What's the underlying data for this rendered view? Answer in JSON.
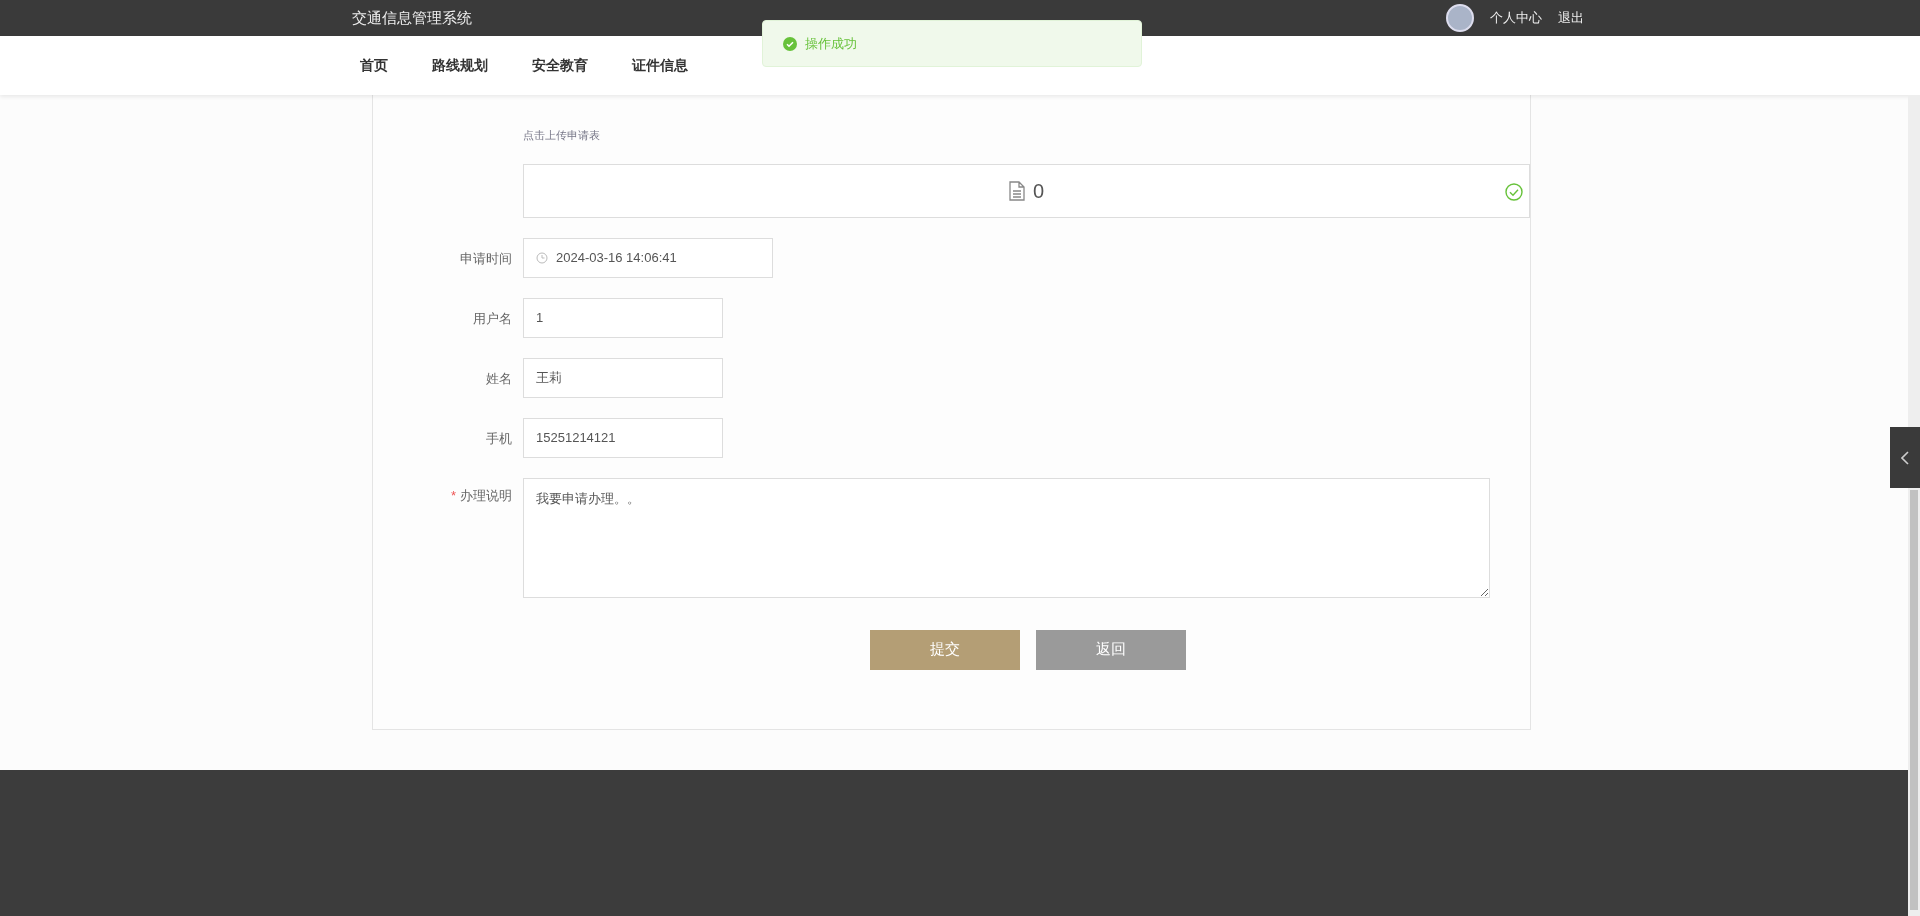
{
  "header": {
    "title": "交通信息管理系统",
    "user_links": [
      {
        "label": "个人中心"
      },
      {
        "label": "退出"
      }
    ]
  },
  "nav": {
    "items": [
      {
        "label": "首页"
      },
      {
        "label": "路线规划"
      },
      {
        "label": "安全教育"
      },
      {
        "label": "证件信息"
      }
    ]
  },
  "toast": {
    "message": "操作成功"
  },
  "form": {
    "upload": {
      "hint": "点击上传申请表",
      "file_count": "0"
    },
    "fields": [
      {
        "kind": "date",
        "label": "申请时间",
        "value": "2024-03-16 14:06:41"
      },
      {
        "kind": "text",
        "label": "用户名",
        "value": "1"
      },
      {
        "kind": "text",
        "label": "姓名",
        "value": "王莉"
      },
      {
        "kind": "text",
        "label": "手机",
        "value": "15251214121"
      },
      {
        "kind": "textarea",
        "label": "办理说明",
        "required_mark": "*",
        "value": "我要申请办理。。"
      }
    ],
    "buttons": [
      {
        "kind": "primary",
        "label": "提交"
      },
      {
        "kind": "secondary",
        "label": "返回"
      }
    ]
  }
}
